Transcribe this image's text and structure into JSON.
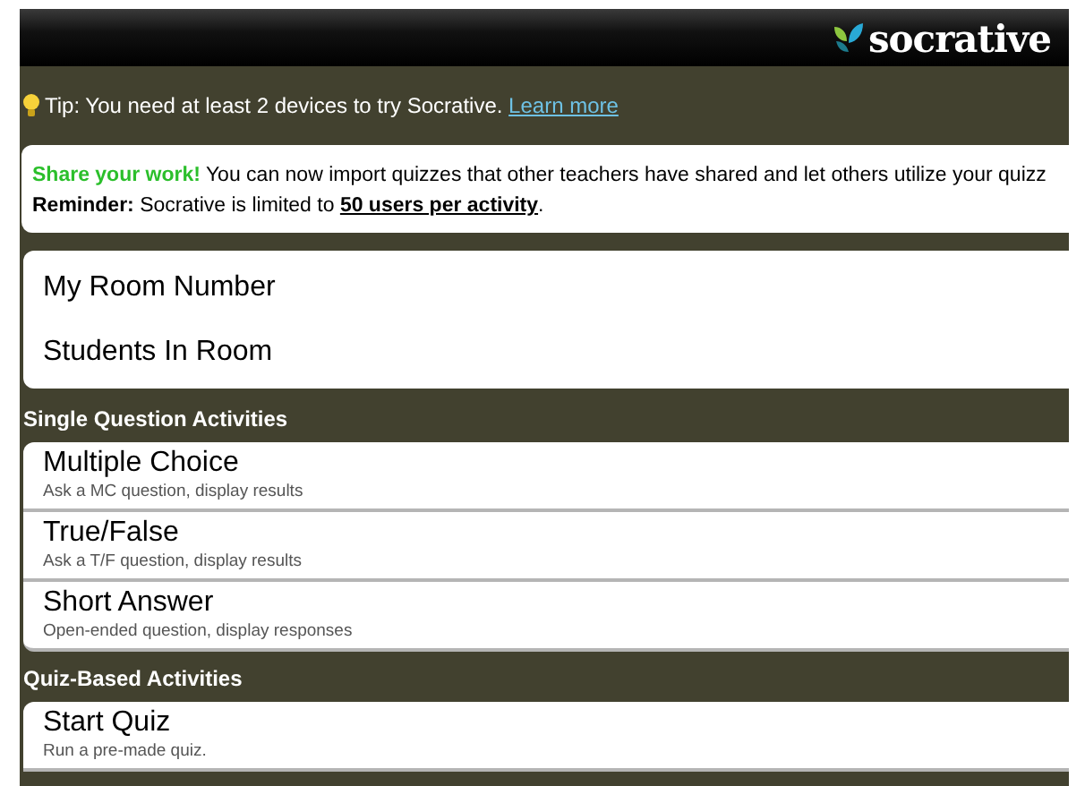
{
  "header": {
    "logo": "socrative"
  },
  "tip": {
    "text": "Tip: You need at least 2 devices to try Socrative.",
    "link": "Learn more"
  },
  "notice": {
    "share": "**Share your work!** You can now import quizzes that other teachers have shared and let others utilize your quizz",
    "reminder": {
      "label": "Reminder:",
      "text": "Socrative is limited to",
      "link": "50 users per activity",
      "end": "."
    }
  },
  "room": [
    "My Room Number",
    "Students In Room"
  ],
  "sections": [
    {
      "title": "Single Question Activities",
      "items": [
        {
          "title": "Multiple Choice",
          "subtitle": "Ask a MC question, display results"
        },
        {
          "title": "True/False",
          "subtitle": "Ask a T/F question, display results"
        },
        {
          "title": "Short Answer",
          "subtitle": "Open-ended question, display responses"
        }
      ]
    },
    {
      "title": "Quiz-Based Activities",
      "items": [
        {
          "title": "Start Quiz",
          "subtitle": "Run a pre-made quiz."
        }
      ]
    }
  ]
}
